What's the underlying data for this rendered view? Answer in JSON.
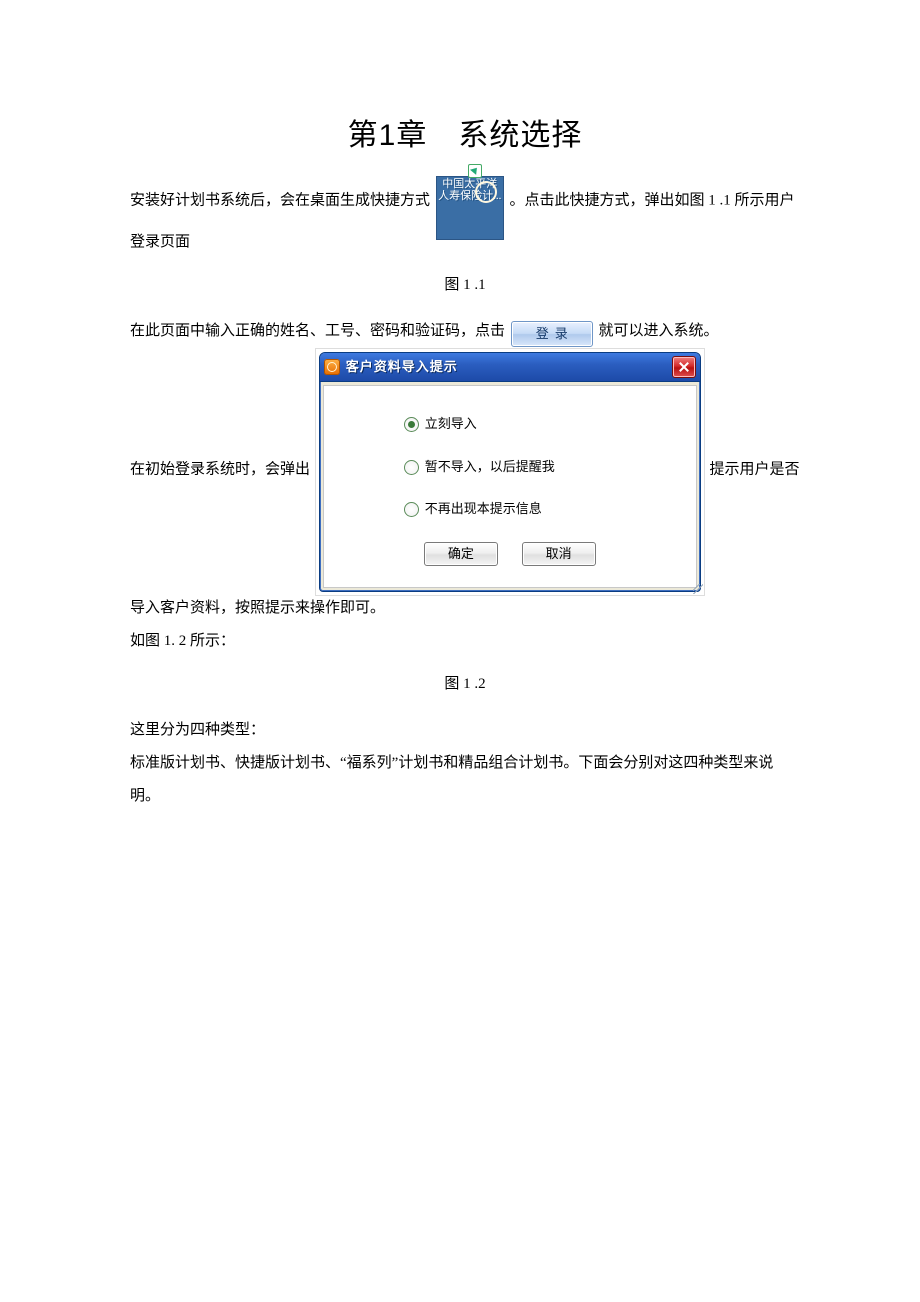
{
  "title": "第1章　系统选择",
  "para1a": "安装好计划书系统后，会在桌面生成快捷方式",
  "desktop_icon_caption": "中国太平洋人寿保险计...",
  "para1b": "。点击此快捷方式，弹出如图 1 .1 所示用户登录页面",
  "figure1": "图 1 .1",
  "para2a": "在此页面中输入正确的姓名、工号、密码和验证码，点击",
  "login_button_label": "登录",
  "para2b": "就可以进入系统。",
  "para3a": "在初始登录系统时，会弹出",
  "para3b": "提示用户是否导入客户资料，按照提示来操作即可。",
  "para4": "如图 1. 2 所示：",
  "figure2": "图 1 .2",
  "para5": "这里分为四种类型：",
  "para6": "标准版计划书、快捷版计划书、“福系列”计划书和精品组合计划书。下面会分别对这四种类型来说明。",
  "dialog": {
    "title": "客户资料导入提示",
    "options": [
      {
        "label": "立刻导入",
        "checked": true
      },
      {
        "label": "暂不导入，以后提醒我",
        "checked": false
      },
      {
        "label": "不再出现本提示信息",
        "checked": false
      }
    ],
    "ok": "确定",
    "cancel": "取消"
  }
}
